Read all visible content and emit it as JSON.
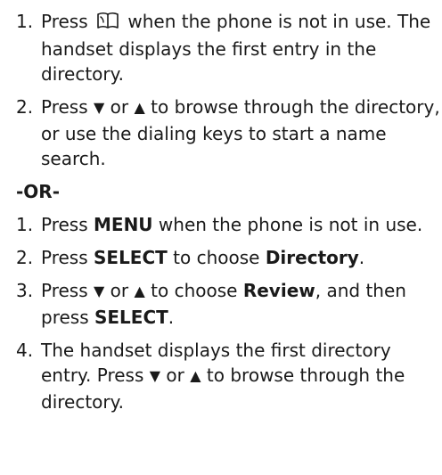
{
  "section_a": {
    "steps": [
      {
        "num": "1.",
        "pre": "Press",
        "icon": "directory-book-icon",
        "post": "when the phone is not in use. The handset displays the first entry in the directory."
      },
      {
        "num": "2.",
        "pre": "Press",
        "down": "▼",
        "or": "or",
        "up": "▲",
        "post": "to browse through the directory, or use the dialing keys to start a name search."
      }
    ]
  },
  "separator": "-OR-",
  "section_b": {
    "steps": [
      {
        "num": "1.",
        "pre": "Press",
        "key": "MENU",
        "post": "when the phone is not in use."
      },
      {
        "num": "2.",
        "pre": "Press",
        "key": "SELECT",
        "mid": "to choose",
        "target": "Directory",
        "post": "."
      },
      {
        "num": "3.",
        "pre": "Press",
        "down": "▼",
        "or": "or",
        "up": "▲",
        "mid": "to choose",
        "target": "Review",
        "mid2": ", and then press",
        "key": "SELECT",
        "post": "."
      },
      {
        "num": "4.",
        "pre": "The handset displays the first directory entry. Press",
        "down": "▼",
        "or": "or",
        "up": "▲",
        "post": "to browse through the directory."
      }
    ]
  }
}
